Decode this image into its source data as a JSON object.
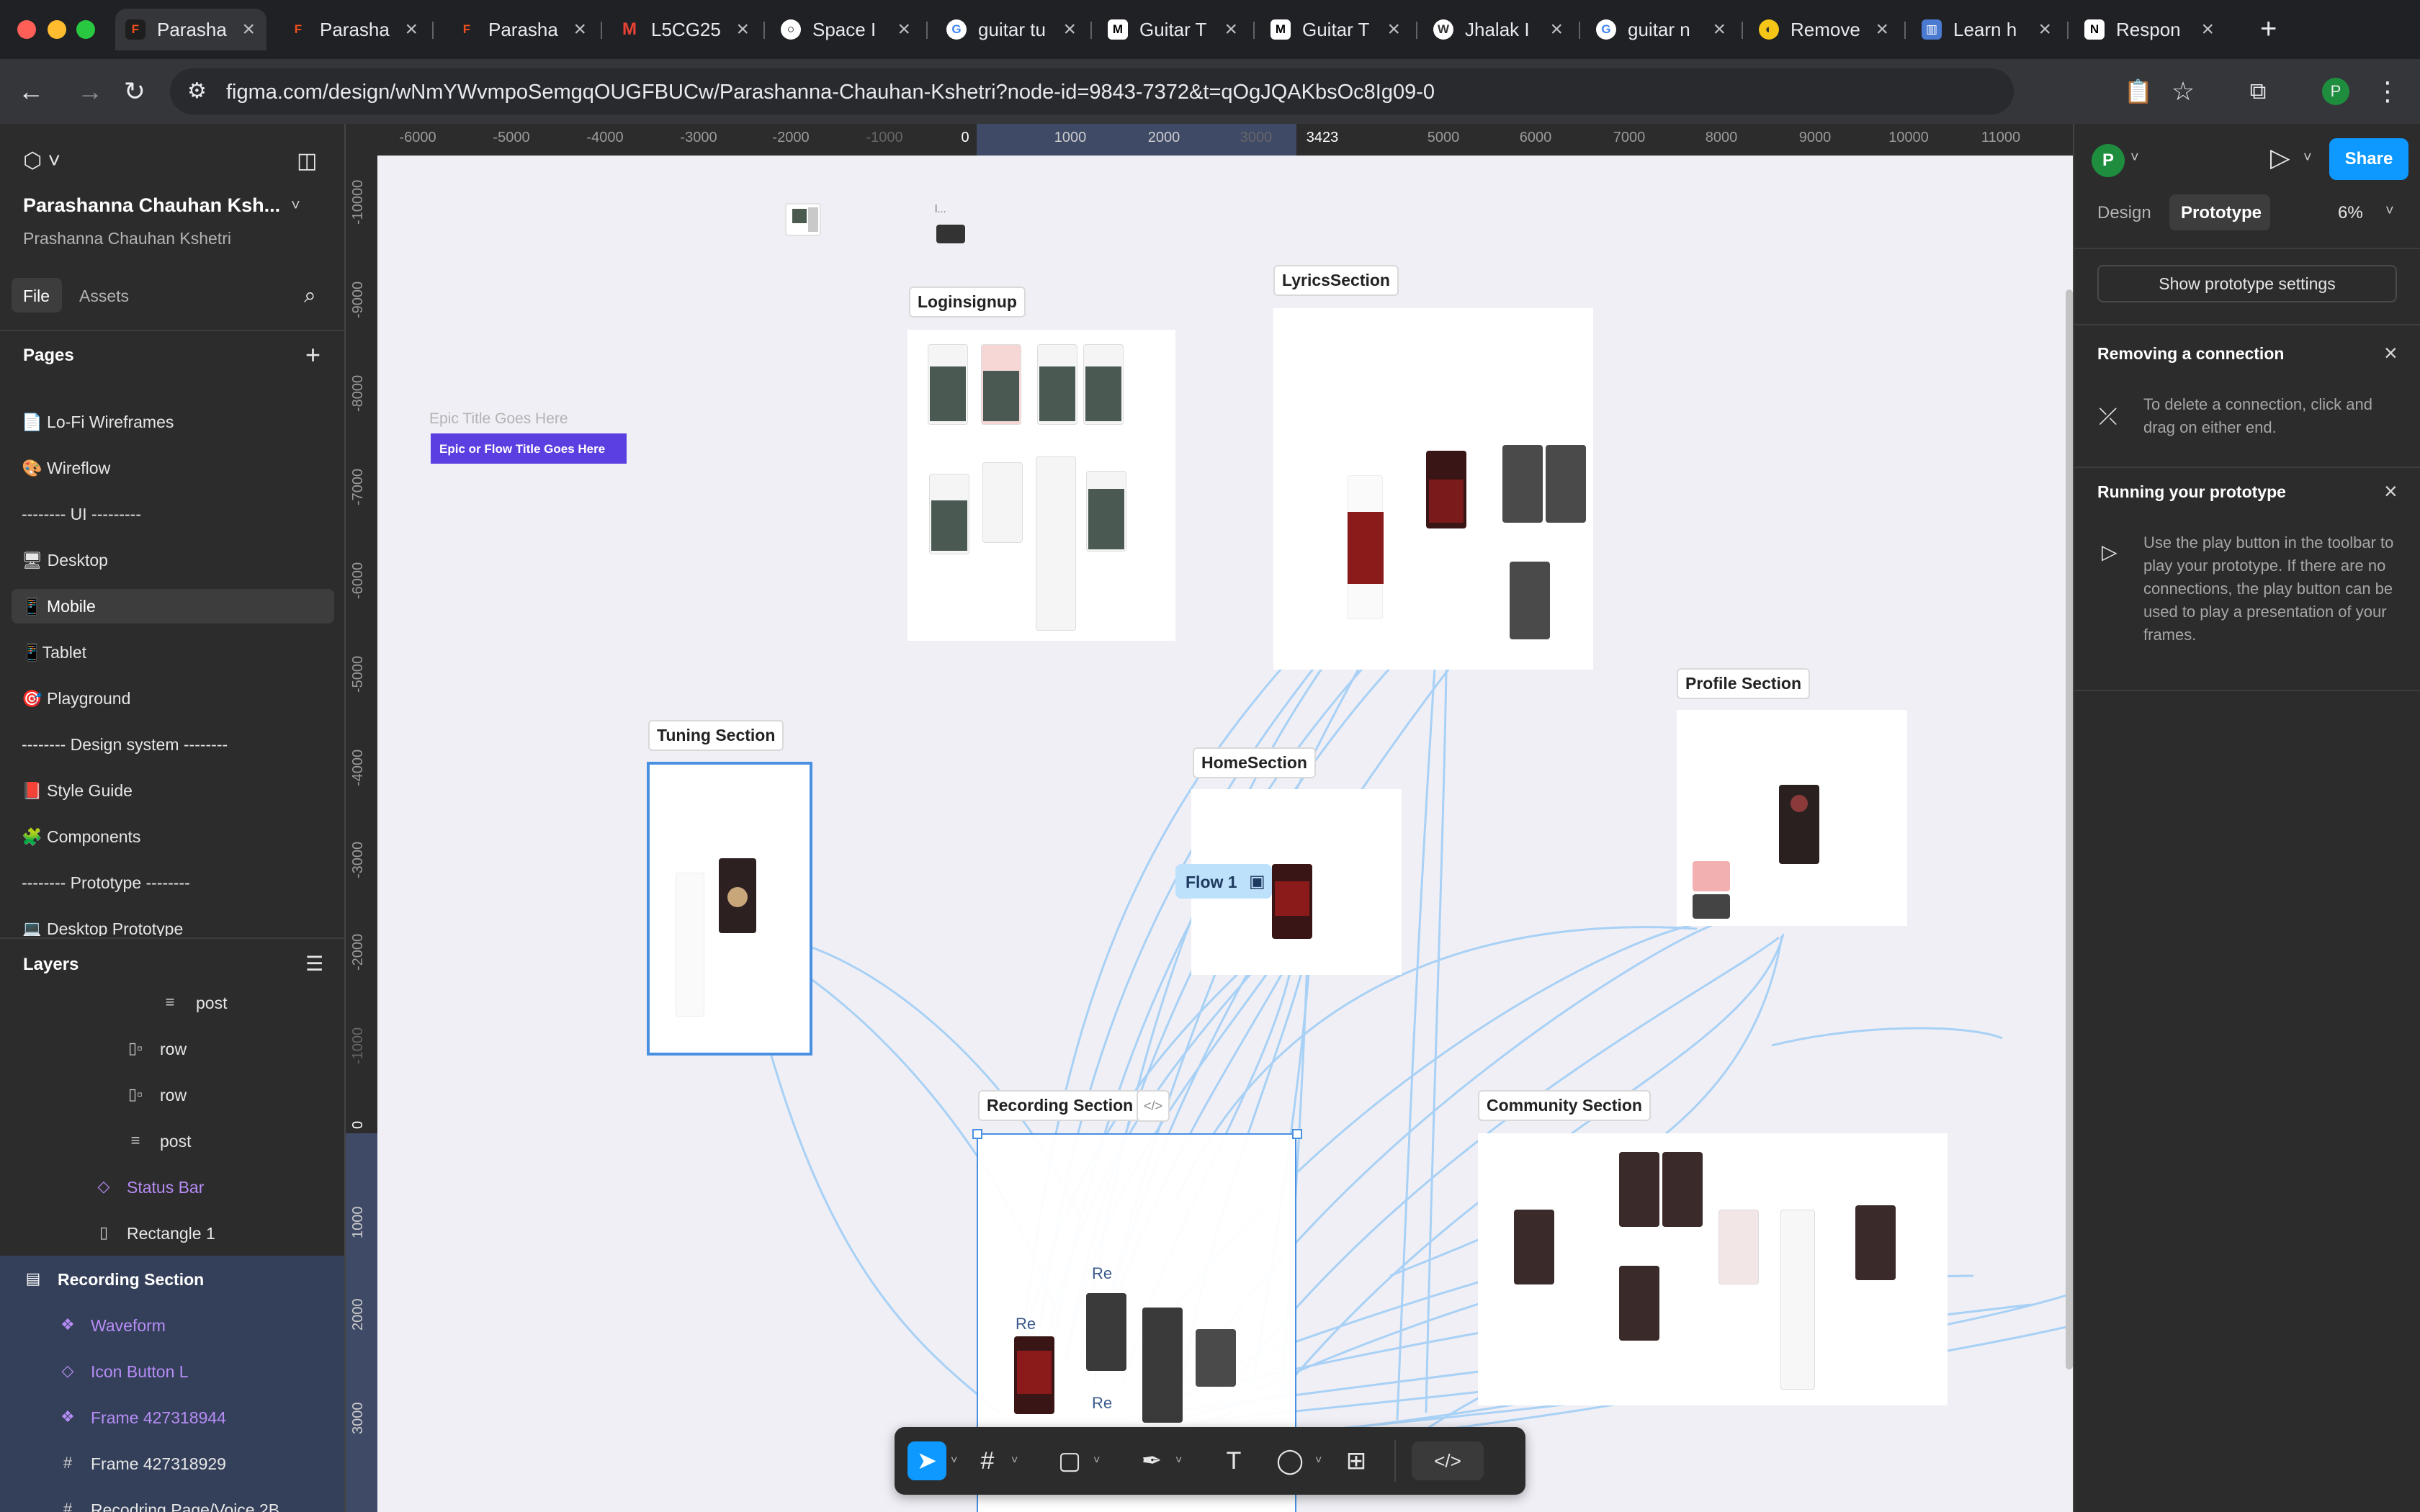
{
  "browser": {
    "tabs": [
      {
        "label": "Parasha",
        "favicon": "figma-icon",
        "active": true
      },
      {
        "label": "Parasha",
        "favicon": "figma-icon"
      },
      {
        "label": "Parasha",
        "favicon": "figma-icon"
      },
      {
        "label": "L5CG25",
        "favicon": "gmail-icon"
      },
      {
        "label": "Space I",
        "favicon": "space-icon"
      },
      {
        "label": "guitar tu",
        "favicon": "google-icon"
      },
      {
        "label": "Guitar T",
        "favicon": "medium-icon"
      },
      {
        "label": "Guitar T",
        "favicon": "medium-icon"
      },
      {
        "label": "Jhalak I",
        "favicon": "wordpress-icon"
      },
      {
        "label": "guitar n",
        "favicon": "google-icon"
      },
      {
        "label": "Remove",
        "favicon": "remove-bg-icon"
      },
      {
        "label": "Learn h",
        "favicon": "learn-icon"
      },
      {
        "label": "Respon",
        "favicon": "notion-icon"
      }
    ],
    "url": "figma.com/design/wNmYWvmpoSemgqOUGFBUCw/Parashanna-Chauhan-Kshetri?node-id=9843-7372&t=qOgJQAKbsOc8Ig09-0",
    "profile_initial": "P"
  },
  "left": {
    "file_name": "Parashanna Chauhan Ksh...",
    "team_name": "Prashanna Chauhan Kshetri",
    "tab_file": "File",
    "tab_assets": "Assets",
    "pages_header": "Pages",
    "pages": [
      "📄 Lo-Fi Wireframes",
      "🎨 Wireflow",
      "-------- UI ---------",
      "🖥 Desktop",
      "📱 Mobile",
      "📱Tablet",
      "🎯 Playground",
      "-------- Design system --------",
      "📕 Style Guide",
      "🧩 Components",
      "-------- Prototype --------",
      "💻 Desktop Prototype"
    ],
    "layers_header": "Layers",
    "layers": [
      {
        "name": "post",
        "icon": "frame-stack-icon"
      },
      {
        "name": "row",
        "icon": "auto-layout-icon"
      },
      {
        "name": "row",
        "icon": "auto-layout-icon"
      },
      {
        "name": "post",
        "icon": "frame-stack-icon"
      },
      {
        "name": "Status Bar",
        "icon": "instance-icon"
      },
      {
        "name": "Rectangle 1",
        "icon": "rectangle-icon"
      },
      {
        "name": "Recording Section",
        "icon": "section-icon"
      },
      {
        "name": "Waveform",
        "icon": "component-icon"
      },
      {
        "name": "Icon Button L",
        "icon": "instance-icon"
      },
      {
        "name": "Frame 427318944",
        "icon": "component-icon"
      },
      {
        "name": "Frame 427318929",
        "icon": "frame-icon"
      },
      {
        "name": "Recodring Page/Voice 2B",
        "icon": "frame-icon"
      }
    ]
  },
  "canvas": {
    "ruler_top": [
      "-6000",
      "-5000",
      "-4000",
      "-3000",
      "-2000",
      "-1000",
      "0",
      "1000",
      "2000",
      "3000",
      "3423",
      "5000",
      "6000",
      "7000",
      "8000",
      "9000",
      "10000",
      "11000"
    ],
    "ruler_left": [
      "-10000",
      "-9000",
      "-8000",
      "-7000",
      "-6000",
      "-5000",
      "-4000",
      "-3000",
      "-2000",
      "-1000",
      "0",
      "1000",
      "2000",
      "3000"
    ],
    "epic_title_placeholder": "Epic Title Goes Here",
    "epic_flow_title": "Epic or Flow Title Goes Here",
    "small_frame_label": "l...",
    "sections": {
      "login": "Loginsignup",
      "lyrics": "LyricsSection",
      "profile": "Profile Section",
      "tuning": "Tuning Section",
      "home": "HomeSection",
      "recording": "Recording Section",
      "community": "Community Section"
    },
    "flow_label": "Flow 1",
    "re_labels": [
      "Re",
      "Re",
      "Re"
    ],
    "connection_color": "#a8d1f5",
    "selection_color": "#4a90e2"
  },
  "toolbar": {
    "tools": [
      "move-tool",
      "frame-tool",
      "shape-tool",
      "pen-tool",
      "text-tool",
      "comment-tool",
      "actions-tool",
      "dev-mode-toggle"
    ]
  },
  "right": {
    "avatar_initial": "P",
    "share_label": "Share",
    "tab_design": "Design",
    "tab_prototype": "Prototype",
    "zoom": "6%",
    "show_settings": "Show prototype settings",
    "removing_title": "Removing a connection",
    "removing_text": "To delete a connection, click and drag on either end.",
    "running_title": "Running your prototype",
    "running_text": "Use the play button in the toolbar to play your prototype. If there are no connections, the play button can be used to play a presentation of your frames."
  }
}
